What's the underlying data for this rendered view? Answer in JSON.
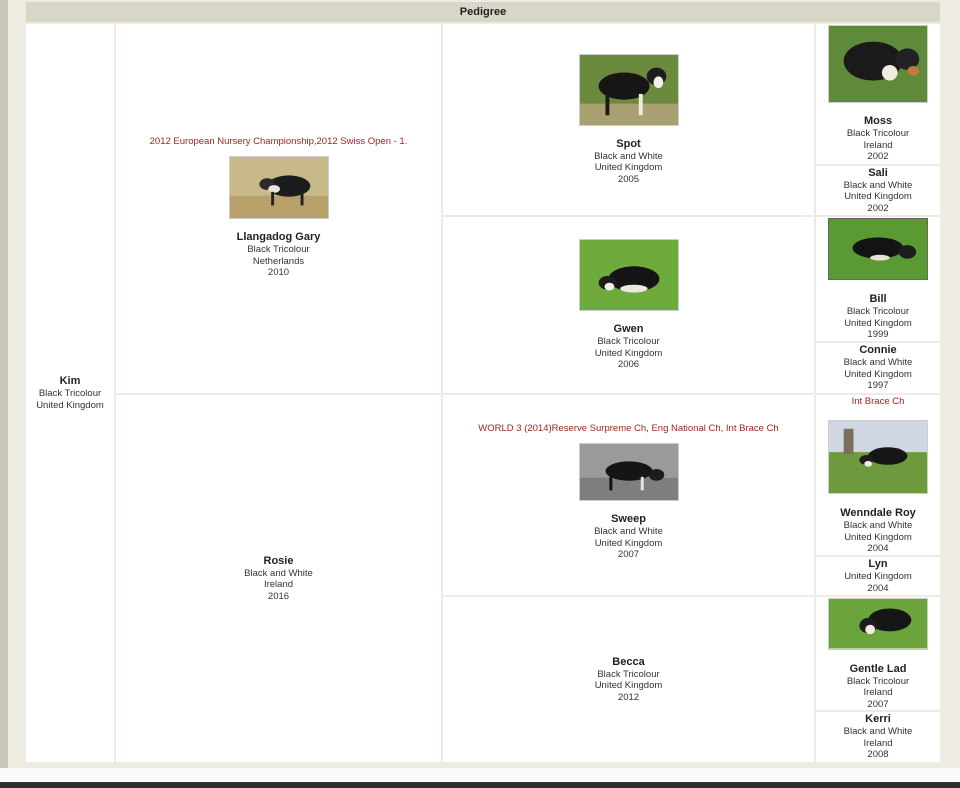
{
  "header": {
    "title": "Pedigree"
  },
  "gen1": {
    "name": "Kim",
    "color": "Black Tricolour",
    "country": "United Kingdom"
  },
  "gen2": [
    {
      "name": "Llangadog Gary",
      "color": "Black Tricolour",
      "country": "Netherlands",
      "year": "2010",
      "achievement": "2012 European Nursery Championship,2012 Swiss Open - 1.",
      "photo": "dog-running-photo"
    },
    {
      "name": "Rosie",
      "color": "Black and White",
      "country": "Ireland",
      "year": "2016"
    }
  ],
  "gen3": [
    {
      "name": "Spot",
      "color": "Black and White",
      "country": "United Kingdom",
      "year": "2005",
      "photo": "dog-standing-photo"
    },
    {
      "name": "Gwen",
      "color": "Black Tricolour",
      "country": "United Kingdom",
      "year": "2006",
      "photo": "dog-crouching-photo"
    },
    {
      "name": "Sweep",
      "color": "Black and White",
      "country": "United Kingdom",
      "year": "2007",
      "achievement": "WORLD 3 (2014)Reserve Surpreme Ch, Eng National Ch, Int Brace Ch",
      "photo": "dog-working-photo"
    },
    {
      "name": "Becca",
      "color": "Black Tricolour",
      "country": "United Kingdom",
      "year": "2012"
    }
  ],
  "gen4": [
    {
      "name": "Moss",
      "color": "Black Tricolour",
      "country": "Ireland",
      "year": "2002",
      "photo": "dog-portrait-photo"
    },
    {
      "name": "Sali",
      "color": "Black and White",
      "country": "United Kingdom",
      "year": "2002"
    },
    {
      "name": "Bill",
      "color": "Black Tricolour",
      "country": "United Kingdom",
      "year": "1999",
      "photo": "dog-running-field-photo"
    },
    {
      "name": "Connie",
      "color": "Black and White",
      "country": "United Kingdom",
      "year": "1997"
    },
    {
      "name": "Wenndale Roy",
      "color": "Black and White",
      "country": "United Kingdom",
      "year": "2004",
      "achievement": "Int Brace Ch",
      "photo": "dog-herding-photo"
    },
    {
      "name": "Lyn",
      "country": "United Kingdom",
      "year": "2004"
    },
    {
      "name": "Gentle Lad",
      "color": "Black Tricolour",
      "country": "Ireland",
      "year": "2007",
      "photo": "dog-crouch-grass-photo"
    },
    {
      "name": "Kerri",
      "color": "Black and White",
      "country": "Ireland",
      "year": "2008"
    }
  ],
  "colors": {
    "header_bg": "#d8d6c6",
    "achievement": "#a3231f",
    "cell_bg": "#ffffff",
    "frame_bg": "#eeece2"
  }
}
